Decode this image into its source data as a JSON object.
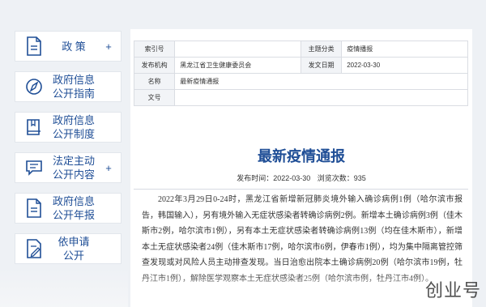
{
  "sidebar": {
    "items": [
      {
        "label": "政 策",
        "icon": "document-icon",
        "plus": "+"
      },
      {
        "label": "政府信息\n公开指南",
        "icon": "compass-icon",
        "plus": ""
      },
      {
        "label": "政府信息\n公开制度",
        "icon": "book-icon",
        "plus": ""
      },
      {
        "label": "法定主动\n公开内容",
        "icon": "chat-list-icon",
        "plus": "+"
      },
      {
        "label": "政府信息\n公开年报",
        "icon": "report-icon",
        "plus": ""
      },
      {
        "label": "依申请\n公开",
        "icon": "form-edit-icon",
        "plus": ""
      }
    ]
  },
  "meta": {
    "index_label": "索引号",
    "index_value": "",
    "category_label": "主题分类",
    "category_value": "疫情播报",
    "org_label": "发布机构",
    "org_value": "黑龙江省卫生健康委员会",
    "date_label": "发文日期",
    "date_value": "2022-03-30",
    "name_label": "名称",
    "name_value": "最新疫情通报",
    "docno_label": "文号",
    "docno_value": ""
  },
  "article": {
    "title": "最新疫情通报",
    "publish_time_label": "发布时间：",
    "publish_time": "2022-03-30",
    "views_label": "浏览次数：",
    "views": "935",
    "body": "2022年3月29日0-24时，黑龙江省新增新冠肺炎境外输入确诊病例1例（哈尔滨市报告，韩国输入），另有境外输入无症状感染者转确诊病例2例。新增本土确诊病例3例（佳木斯市2例，哈尔滨市1例），另有本土无症状感染者转确诊病例13例（均在佳木斯市），新增本土无症状感染者24例（佳木斯市17例，哈尔滨市6例，伊春市1例），均为集中隔离管控筛查发现或对风险人员主动排查发现。当日治愈出院本土确诊病例20例（哈尔滨市19例，牡丹江市1例），解除医学观察本土无症状感染者25例（哈尔滨市例，牡丹江市4例）。"
  },
  "watermark": "创业号"
}
